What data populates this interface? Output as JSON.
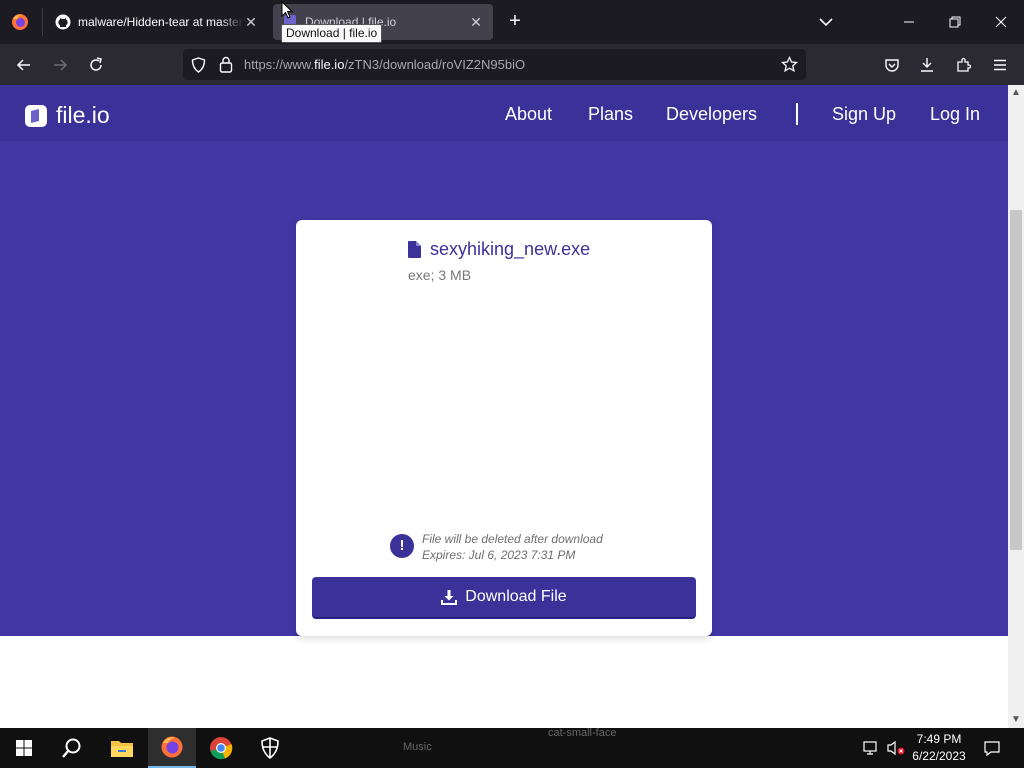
{
  "browser": {
    "tabs": [
      {
        "label": "malware/Hidden-tear at master"
      },
      {
        "label": "Download | file.io"
      }
    ],
    "tooltip": "Download | file.io",
    "url": {
      "prefix": "https://www.",
      "host": "file.io",
      "path": "/zTN3/download/roVIZ2N95biO"
    }
  },
  "site": {
    "logo": "file.io",
    "nav": {
      "about": "About",
      "plans": "Plans",
      "developers": "Developers",
      "signup": "Sign Up",
      "login": "Log In"
    },
    "brand_color": "#3a3199"
  },
  "file": {
    "name": "sexyhiking_new.exe",
    "meta": "exe; 3 MB",
    "warning_line1": "File will be deleted after download",
    "warning_line2": "Expires: Jul 6, 2023 7:31 PM",
    "download_label": "Download File"
  },
  "taskbar": {
    "ghost_music": "Music",
    "ghost_file": "cat-small-face",
    "time": "7:49 PM",
    "date": "6/22/2023"
  },
  "icons": [
    "firefox-icon",
    "github-icon",
    "close-icon",
    "plus-icon",
    "chevron-down-icon",
    "back-icon",
    "forward-icon",
    "reload-icon",
    "shield-icon",
    "lock-icon",
    "star-icon",
    "pocket-icon",
    "download-icon",
    "extensions-icon",
    "menu-icon",
    "file-icon",
    "exclamation-icon",
    "windows-start-icon",
    "search-icon",
    "file-explorer-icon",
    "chrome-icon",
    "security-icon",
    "network-icon",
    "volume-muted-icon",
    "notifications-icon"
  ]
}
